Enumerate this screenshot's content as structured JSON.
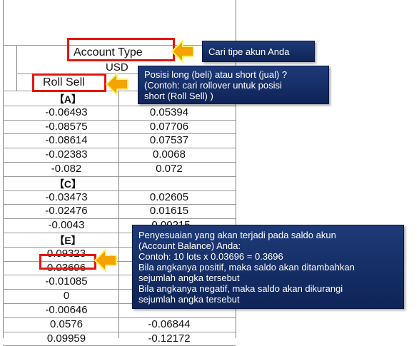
{
  "table": {
    "header": {
      "account_type": "Account Type",
      "currency": "USD",
      "roll_sell": "Roll Sell"
    },
    "sections": [
      {
        "label": "【A】",
        "rows": [
          [
            "-0.06493",
            "0.05394"
          ],
          [
            "-0.08575",
            "0.07706"
          ],
          [
            "-0.08614",
            "0.07537"
          ],
          [
            "-0.02383",
            "0.0068"
          ],
          [
            "-0.082",
            "0.072"
          ]
        ]
      },
      {
        "label": "【C】",
        "rows": [
          [
            "-0.03473",
            "0.02605"
          ],
          [
            "-0.02476",
            "0.01615"
          ],
          [
            "-0.0043",
            "-0.00215"
          ]
        ]
      },
      {
        "label": "【E】",
        "rows": [
          [
            "0.09323",
            ""
          ],
          [
            "0.03696",
            ""
          ],
          [
            "-0.01085",
            ""
          ],
          [
            "0",
            ""
          ],
          [
            "-0.00646",
            ""
          ],
          [
            "0.0576",
            "-0.06844"
          ],
          [
            "0.09959",
            "-0.12172"
          ]
        ]
      }
    ]
  },
  "callouts": {
    "account_type": "Cari tipe akun Anda",
    "position": [
      "Posisi long (beli) atau short (jual) ?",
      "(Contoh: cari rollover untuk posisi",
      "short (Roll Sell) )"
    ],
    "adjustment": [
      "Penyesuaian yang akan terjadi pada saldo akun",
      "(Account Balance) Anda:",
      "Contoh: 10 lots x 0.03696 = 0.3696",
      "Bila angkanya positif, maka saldo akan ditambahkan",
      "sejumlah angka tersebut",
      "Bila angkanya negatif, maka saldo akan dikurangi",
      "sejumlah angka tersebut"
    ]
  },
  "colors": {
    "highlight_box": "#e8140f",
    "arrow": "#f5a300",
    "callout_bg": "#1d3a78"
  }
}
